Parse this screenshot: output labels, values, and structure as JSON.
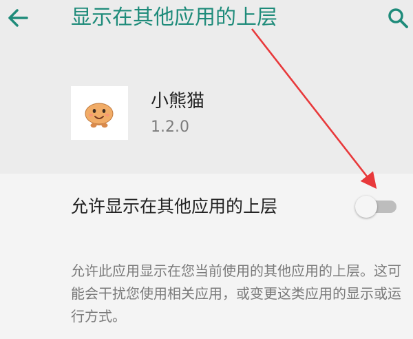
{
  "header": {
    "title": "显示在其他应用的上层",
    "back_icon": "arrow-left-icon",
    "search_icon": "search-icon"
  },
  "app": {
    "name": "小熊猫",
    "version": "1.2.0",
    "icon": "app-face-icon"
  },
  "setting": {
    "label": "允许显示在其他应用的上层",
    "toggle_enabled": false
  },
  "description": "允许此应用显示在您当前使用的其他应用的上层。这可能会干扰您使用相关应用，或变更这类应用的显示或运行方式。",
  "colors": {
    "accent": "#1e8b7a",
    "annotation": "#e8393b"
  }
}
